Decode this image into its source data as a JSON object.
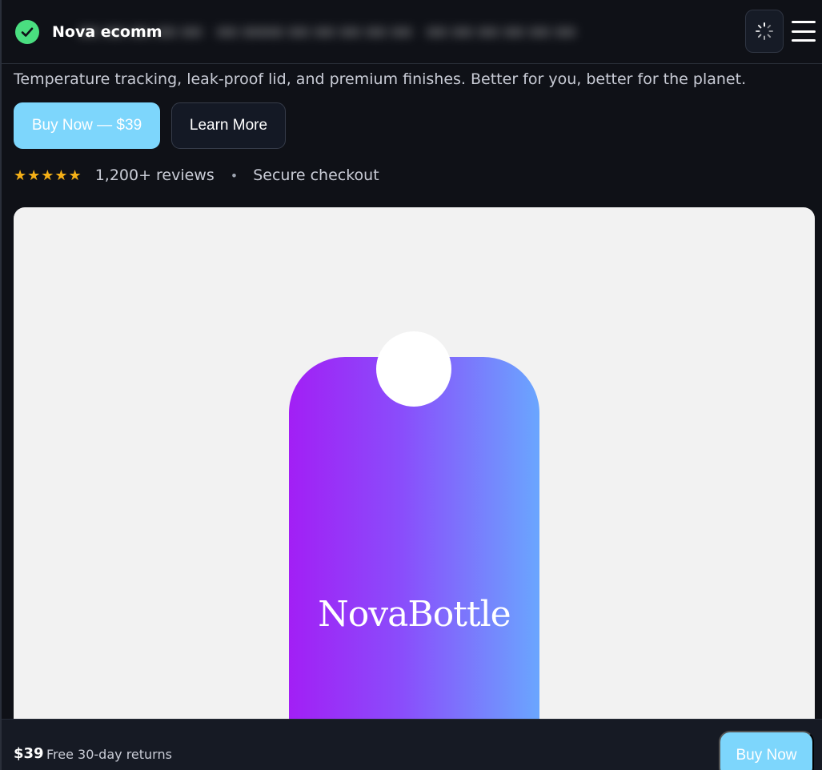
{
  "header": {
    "brand_name": "Nova ecomm",
    "brand_check_color": "#4ade80",
    "loading_icon": "spinner-icon",
    "menu_icon": "hamburger-menu-icon"
  },
  "hero": {
    "subtitle": "Temperature tracking, leak-proof lid, and premium finishes. Better for you, better for the planet.",
    "buy_button_label": "Buy Now — $39",
    "learn_more_label": "Learn More",
    "stars": "★★★★★",
    "reviews": "1,200+ reviews",
    "separator": "•",
    "secure_checkout": "Secure checkout"
  },
  "product_image": {
    "label": "NovaBottle",
    "gradient_start": "#a21ff5",
    "gradient_end": "#6aa6fe"
  },
  "footer": {
    "price": "$39",
    "note": "Free 30-day returns",
    "buy_label": "Buy Now"
  },
  "colors": {
    "accent": "#7dd6fc",
    "background": "#0f1117",
    "star": "#f5b017"
  }
}
